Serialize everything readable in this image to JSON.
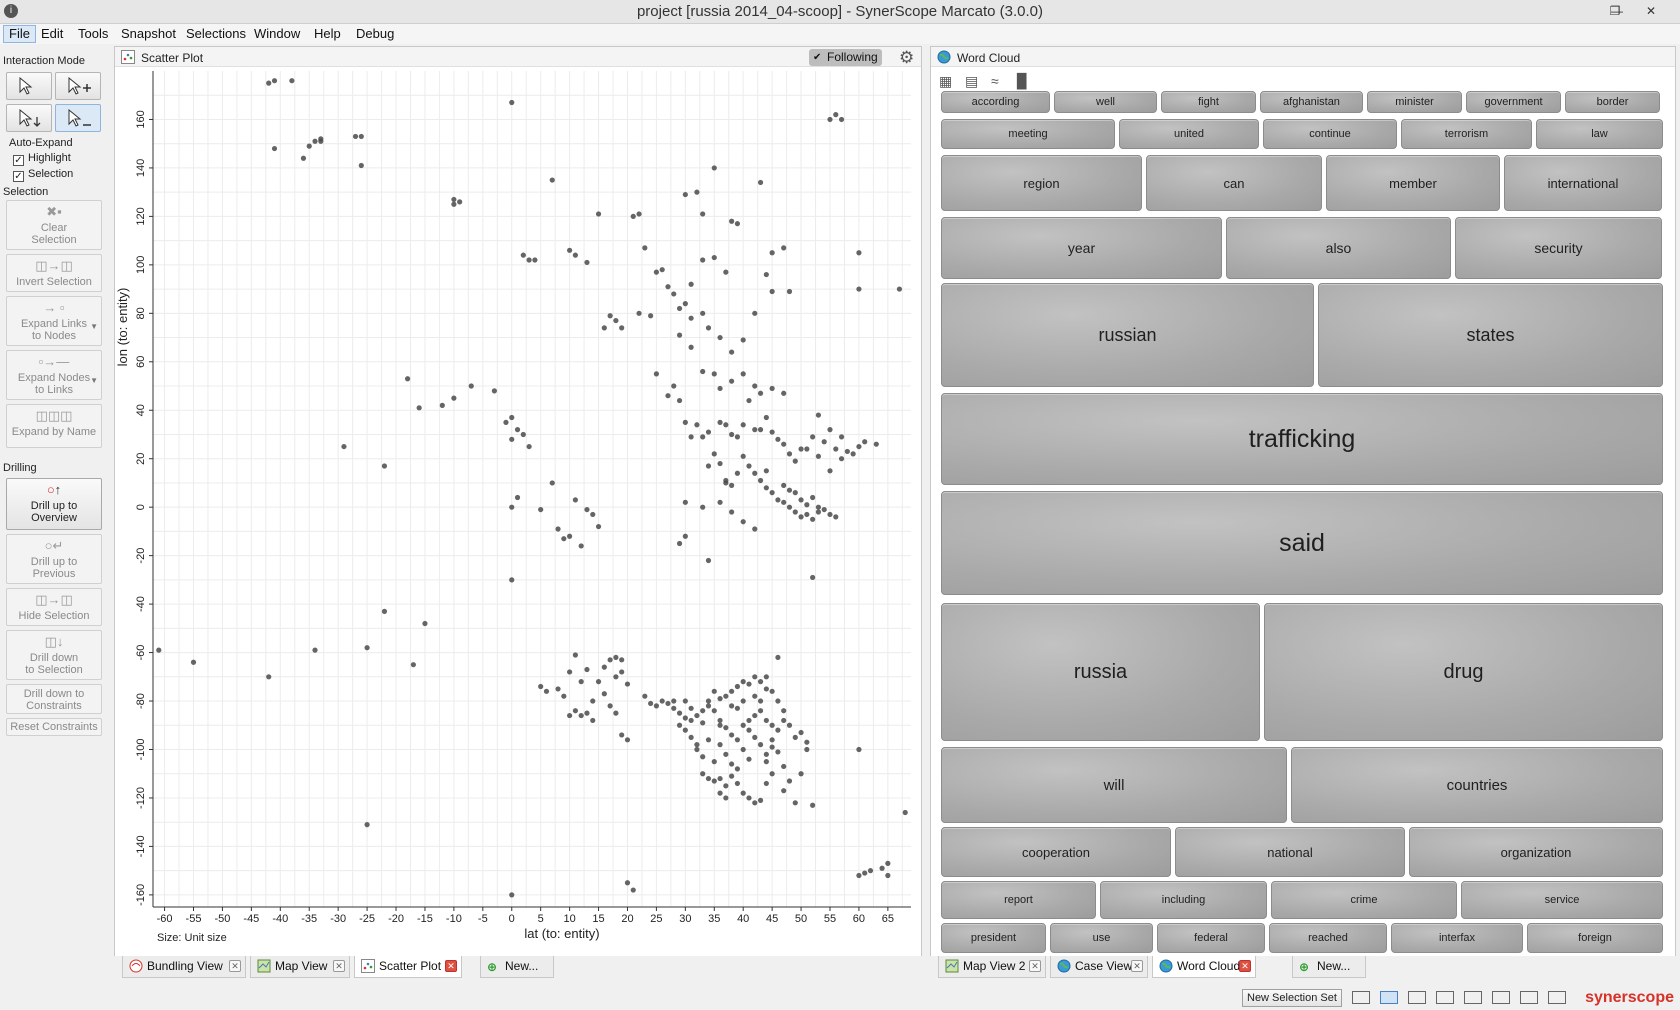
{
  "window": {
    "title": "project [russia 2014_04-scoop] - SynerScope Marcato (3.0.0)"
  },
  "menu": [
    "File",
    "Edit",
    "Tools",
    "Snapshot",
    "Selections",
    "Window",
    "Help",
    "Debug"
  ],
  "left_panel": {
    "interaction_mode": "Interaction Mode",
    "auto_expand": "Auto-Expand",
    "highlight": "Highlight",
    "selection_cb": "Selection",
    "selection_title": "Selection",
    "clear": [
      "Clear",
      "Selection"
    ],
    "invert": "Invert Selection",
    "expand_links": [
      "Expand Links",
      "to Nodes"
    ],
    "expand_nodes": [
      "Expand Nodes",
      "to Links"
    ],
    "expand_name": "Expand by Name",
    "drilling": "Drilling",
    "drill_up_overview": [
      "Drill up to",
      "Overview"
    ],
    "drill_up_previous": [
      "Drill up to",
      "Previous"
    ],
    "hide_selection": "Hide Selection",
    "drill_down_selection": [
      "Drill down",
      "to Selection"
    ],
    "drill_down_constraints": [
      "Drill down to",
      "Constraints"
    ],
    "reset_constraints": "Reset Constraints"
  },
  "scatter_panel": {
    "title": "Scatter Plot",
    "following": "Following",
    "size_label": "Size: Unit size"
  },
  "wordcloud_panel": {
    "title": "Word Cloud"
  },
  "left_tabs": [
    "Bundling View",
    "Map View",
    "Scatter Plot",
    "New..."
  ],
  "right_tabs": [
    "Map View 2",
    "Case View",
    "Word Cloud",
    "New..."
  ],
  "status": {
    "new_selection_set": "New Selection Set",
    "brand": "synerscope"
  },
  "colors": {
    "accent": "#d6322a",
    "word_tile": "#a9a9a9",
    "point": "#4a4a4a"
  },
  "chart_data": {
    "type": "scatter",
    "xlabel": "lat (to: entity)",
    "ylabel": "lon (to: entity)",
    "xlim": [
      -62,
      69
    ],
    "ylim": [
      -165,
      180
    ],
    "xticks": [
      -60,
      -55,
      -50,
      -45,
      -40,
      -35,
      -30,
      -25,
      -20,
      -15,
      -10,
      -5,
      0,
      5,
      10,
      15,
      20,
      25,
      30,
      35,
      40,
      45,
      50,
      55,
      60,
      65
    ],
    "yticks": [
      -160,
      -140,
      -120,
      -100,
      -80,
      -60,
      -40,
      -20,
      0,
      20,
      40,
      60,
      80,
      100,
      120,
      140,
      160
    ],
    "grid": true,
    "points": [
      [
        -42,
        175
      ],
      [
        -41,
        176
      ],
      [
        -38,
        176
      ],
      [
        -41,
        148
      ],
      [
        -36,
        144
      ],
      [
        -35,
        149
      ],
      [
        -34,
        151
      ],
      [
        -33,
        152
      ],
      [
        -33,
        151
      ],
      [
        -27,
        153
      ],
      [
        -26,
        153
      ],
      [
        -26,
        141
      ],
      [
        0,
        167
      ],
      [
        -10,
        125
      ],
      [
        -10,
        127
      ],
      [
        -9,
        126
      ],
      [
        7,
        135
      ],
      [
        2,
        104
      ],
      [
        3,
        102
      ],
      [
        4,
        102
      ],
      [
        10,
        106
      ],
      [
        11,
        104
      ],
      [
        13,
        101
      ],
      [
        15,
        121
      ],
      [
        55,
        160
      ],
      [
        56,
        162
      ],
      [
        57,
        160
      ],
      [
        67,
        90
      ],
      [
        60,
        105
      ],
      [
        60,
        90
      ],
      [
        30,
        129
      ],
      [
        32,
        130
      ],
      [
        33,
        121
      ],
      [
        35,
        140
      ],
      [
        38,
        118
      ],
      [
        39,
        117
      ],
      [
        43,
        134
      ],
      [
        45,
        105
      ],
      [
        47,
        107
      ],
      [
        31,
        92
      ],
      [
        33,
        80
      ],
      [
        34,
        74
      ],
      [
        36,
        70
      ],
      [
        38,
        64
      ],
      [
        40,
        69
      ],
      [
        42,
        80
      ],
      [
        44,
        96
      ],
      [
        45,
        89
      ],
      [
        48,
        89
      ],
      [
        22,
        121
      ],
      [
        21,
        120
      ],
      [
        23,
        107
      ],
      [
        25,
        97
      ],
      [
        27,
        91
      ],
      [
        28,
        88
      ],
      [
        29,
        82
      ],
      [
        30,
        84
      ],
      [
        31,
        78
      ],
      [
        33,
        102
      ],
      [
        35,
        103
      ],
      [
        37,
        97
      ],
      [
        17,
        79
      ],
      [
        18,
        77
      ],
      [
        16,
        74
      ],
      [
        19,
        74
      ],
      [
        22,
        80
      ],
      [
        24,
        79
      ],
      [
        26,
        98
      ],
      [
        29,
        71
      ],
      [
        31,
        66
      ],
      [
        33,
        56
      ],
      [
        35,
        55
      ],
      [
        36,
        49
      ],
      [
        38,
        52
      ],
      [
        40,
        55
      ],
      [
        42,
        50
      ],
      [
        43,
        47
      ],
      [
        45,
        49
      ],
      [
        47,
        47
      ],
      [
        25,
        55
      ],
      [
        27,
        46
      ],
      [
        28,
        50
      ],
      [
        29,
        44
      ],
      [
        30,
        35
      ],
      [
        31,
        29
      ],
      [
        32,
        34
      ],
      [
        33,
        29
      ],
      [
        34,
        31
      ],
      [
        36,
        35
      ],
      [
        37,
        34
      ],
      [
        38,
        30
      ],
      [
        39,
        29
      ],
      [
        40,
        34
      ],
      [
        41,
        44
      ],
      [
        42,
        32
      ],
      [
        43,
        32
      ],
      [
        44,
        37
      ],
      [
        45,
        31
      ],
      [
        46,
        28
      ],
      [
        47,
        26
      ],
      [
        48,
        22
      ],
      [
        49,
        19
      ],
      [
        50,
        24
      ],
      [
        51,
        24
      ],
      [
        52,
        29
      ],
      [
        53,
        21
      ],
      [
        54,
        27
      ],
      [
        55,
        32
      ],
      [
        56,
        24
      ],
      [
        57,
        29
      ],
      [
        58,
        23
      ],
      [
        59,
        22
      ],
      [
        60,
        25
      ],
      [
        61,
        27
      ],
      [
        63,
        26
      ],
      [
        53,
        38
      ],
      [
        55,
        15
      ],
      [
        57,
        20
      ],
      [
        35,
        22
      ],
      [
        36,
        18
      ],
      [
        37,
        11
      ],
      [
        38,
        9
      ],
      [
        40,
        21
      ],
      [
        41,
        17
      ],
      [
        42,
        14
      ],
      [
        43,
        11
      ],
      [
        44,
        8
      ],
      [
        45,
        6
      ],
      [
        46,
        3
      ],
      [
        47,
        2
      ],
      [
        48,
        0
      ],
      [
        49,
        -2
      ],
      [
        50,
        -4
      ],
      [
        51,
        -3
      ],
      [
        52,
        -5
      ],
      [
        53,
        -2
      ],
      [
        54,
        -1
      ],
      [
        55,
        -3
      ],
      [
        56,
        -4
      ],
      [
        47,
        9
      ],
      [
        48,
        7
      ],
      [
        49,
        6
      ],
      [
        50,
        3
      ],
      [
        51,
        1
      ],
      [
        52,
        4
      ],
      [
        53,
        0
      ],
      [
        34,
        17
      ],
      [
        36,
        2
      ],
      [
        38,
        -2
      ],
      [
        40,
        -6
      ],
      [
        42,
        -9
      ],
      [
        33,
        0
      ],
      [
        37,
        10
      ],
      [
        39,
        14
      ],
      [
        44,
        15
      ],
      [
        0,
        37
      ],
      [
        -1,
        35
      ],
      [
        0,
        28
      ],
      [
        1,
        4
      ],
      [
        1,
        32
      ],
      [
        2,
        30
      ],
      [
        3,
        25
      ],
      [
        7,
        10
      ],
      [
        8,
        -9
      ],
      [
        9,
        -13
      ],
      [
        10,
        -12
      ],
      [
        12,
        -16
      ],
      [
        15,
        -8
      ],
      [
        14,
        -3
      ],
      [
        13,
        -1
      ],
      [
        11,
        3
      ],
      [
        5,
        -1
      ],
      [
        0,
        0
      ],
      [
        -3,
        48
      ],
      [
        -7,
        50
      ],
      [
        -10,
        45
      ],
      [
        -12,
        42
      ],
      [
        -18,
        53
      ],
      [
        -22,
        17
      ],
      [
        -29,
        25
      ],
      [
        -16,
        41
      ],
      [
        0,
        -30
      ],
      [
        -22,
        -43
      ],
      [
        -15,
        -48
      ],
      [
        -17,
        -65
      ],
      [
        -25,
        -58
      ],
      [
        -34,
        -59
      ],
      [
        -42,
        -70
      ],
      [
        -55,
        -64
      ],
      [
        -61,
        -59
      ],
      [
        -25,
        -131
      ],
      [
        0,
        -160
      ],
      [
        20,
        -155
      ],
      [
        21,
        -158
      ],
      [
        52,
        -29
      ],
      [
        29,
        -15
      ],
      [
        30,
        -12
      ],
      [
        34,
        -22
      ],
      [
        30,
        2
      ],
      [
        60,
        -100
      ],
      [
        68,
        -126
      ],
      [
        64,
        -149
      ],
      [
        65,
        -147
      ],
      [
        65,
        -152
      ],
      [
        61,
        -151
      ],
      [
        60,
        -152
      ],
      [
        62,
        -150
      ],
      [
        5,
        -74
      ],
      [
        6,
        -76
      ],
      [
        10,
        -68
      ],
      [
        10,
        -86
      ],
      [
        11,
        -84
      ],
      [
        12,
        -86
      ],
      [
        13,
        -85
      ],
      [
        14,
        -88
      ],
      [
        15,
        -72
      ],
      [
        16,
        -77
      ],
      [
        17,
        -82
      ],
      [
        18,
        -70
      ],
      [
        19,
        -68
      ],
      [
        20,
        -73
      ],
      [
        18,
        -62
      ],
      [
        19,
        -63
      ],
      [
        17,
        -63
      ],
      [
        16,
        -66
      ],
      [
        18,
        -85
      ],
      [
        19,
        -94
      ],
      [
        20,
        -96
      ],
      [
        23,
        -78
      ],
      [
        24,
        -81
      ],
      [
        25,
        -82
      ],
      [
        26,
        -80
      ],
      [
        28,
        -83
      ],
      [
        29,
        -90
      ],
      [
        30,
        -92
      ],
      [
        31,
        -95
      ],
      [
        32,
        -98
      ],
      [
        11,
        -61
      ],
      [
        12,
        -72
      ],
      [
        9,
        -78
      ],
      [
        8,
        -75
      ],
      [
        14,
        -80
      ],
      [
        13,
        -67
      ],
      [
        30,
        -80
      ],
      [
        31,
        -83
      ],
      [
        32,
        -86
      ],
      [
        33,
        -89
      ],
      [
        34,
        -82
      ],
      [
        35,
        -84
      ],
      [
        36,
        -79
      ],
      [
        37,
        -78
      ],
      [
        38,
        -76
      ],
      [
        39,
        -74
      ],
      [
        40,
        -72
      ],
      [
        41,
        -73
      ],
      [
        42,
        -70
      ],
      [
        43,
        -72
      ],
      [
        44,
        -70
      ],
      [
        36,
        -88
      ],
      [
        37,
        -91
      ],
      [
        38,
        -94
      ],
      [
        39,
        -96
      ],
      [
        40,
        -90
      ],
      [
        41,
        -88
      ],
      [
        42,
        -86
      ],
      [
        43,
        -84
      ],
      [
        44,
        -88
      ],
      [
        45,
        -90
      ],
      [
        32,
        -100
      ],
      [
        33,
        -103
      ],
      [
        34,
        -96
      ],
      [
        35,
        -105
      ],
      [
        36,
        -98
      ],
      [
        37,
        -102
      ],
      [
        38,
        -106
      ],
      [
        39,
        -108
      ],
      [
        40,
        -100
      ],
      [
        41,
        -104
      ],
      [
        42,
        -95
      ],
      [
        43,
        -98
      ],
      [
        44,
        -102
      ],
      [
        45,
        -96
      ],
      [
        46,
        -92
      ],
      [
        47,
        -88
      ],
      [
        48,
        -90
      ],
      [
        49,
        -95
      ],
      [
        50,
        -93
      ],
      [
        51,
        -97
      ],
      [
        46,
        -80
      ],
      [
        47,
        -84
      ],
      [
        33,
        -110
      ],
      [
        34,
        -112
      ],
      [
        35,
        -113
      ],
      [
        36,
        -112
      ],
      [
        37,
        -115
      ],
      [
        38,
        -111
      ],
      [
        39,
        -114
      ],
      [
        40,
        -118
      ],
      [
        41,
        -120
      ],
      [
        42,
        -122
      ],
      [
        43,
        -121
      ],
      [
        44,
        -114
      ],
      [
        45,
        -110
      ],
      [
        37,
        -120
      ],
      [
        36,
        -118
      ],
      [
        47,
        -117
      ],
      [
        49,
        -122
      ],
      [
        50,
        -110
      ],
      [
        51,
        -100
      ],
      [
        52,
        -123
      ],
      [
        46,
        -62
      ],
      [
        44,
        -75
      ],
      [
        45,
        -76
      ],
      [
        43,
        -80
      ],
      [
        35,
        -76
      ],
      [
        34,
        -80
      ],
      [
        33,
        -84
      ],
      [
        31,
        -88
      ],
      [
        30,
        -87
      ],
      [
        29,
        -85
      ],
      [
        28,
        -80
      ],
      [
        27,
        -81
      ],
      [
        45,
        -99
      ],
      [
        44,
        -105
      ],
      [
        46,
        -101
      ],
      [
        47,
        -107
      ],
      [
        48,
        -113
      ],
      [
        38,
        -82
      ],
      [
        40,
        -80
      ],
      [
        41,
        -92
      ],
      [
        42,
        -78
      ],
      [
        39,
        -83
      ],
      [
        36,
        -90
      ]
    ]
  }
}
